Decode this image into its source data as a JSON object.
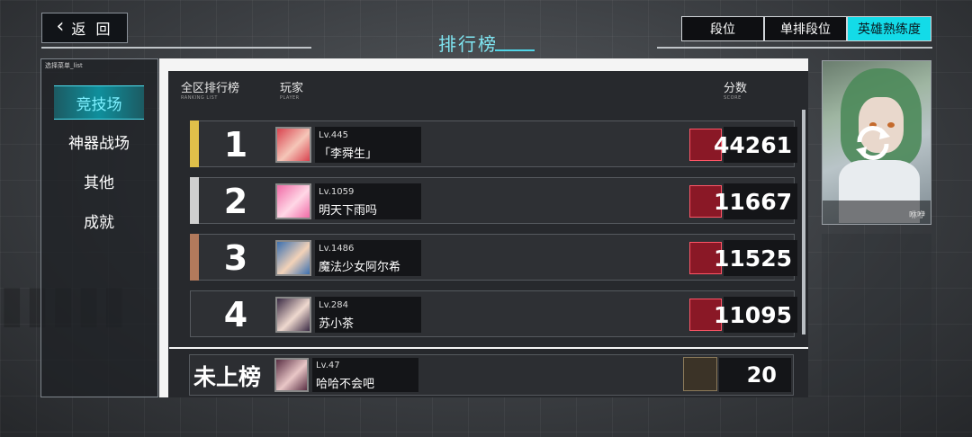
{
  "nav": {
    "back_label": "返 回"
  },
  "page": {
    "title": "排行榜"
  },
  "tabs": [
    {
      "label": "段位",
      "active": false
    },
    {
      "label": "单排段位",
      "active": false
    },
    {
      "label": "英雄熟练度",
      "active": true
    }
  ],
  "sidebar": {
    "caption": "选择菜单_list",
    "items": [
      {
        "label": "竞技场",
        "active": true
      },
      {
        "label": "神器战场",
        "active": false
      },
      {
        "label": "其他",
        "active": false
      },
      {
        "label": "成就",
        "active": false
      }
    ]
  },
  "leaderboard": {
    "headers": {
      "rank_label": "全区排行榜",
      "rank_sub": "RANKING LIST",
      "player_label": "玩家",
      "player_sub": "PLAYER",
      "score_label": "分数",
      "score_sub": "SCORE"
    },
    "rows": [
      {
        "rank": "1",
        "level": "Lv.445",
        "name": "「李舜生」",
        "score": "44261",
        "stripe_color": "#e0c04a",
        "avatar_colors": [
          "#d9434f",
          "#f5c6b8"
        ]
      },
      {
        "rank": "2",
        "level": "Lv.1059",
        "name": "明天下雨吗",
        "score": "11667",
        "stripe_color": "#cfcfcf",
        "avatar_colors": [
          "#f06aa6",
          "#ffd7e6"
        ]
      },
      {
        "rank": "3",
        "level": "Lv.1486",
        "name": "魔法少女阿尔希",
        "score": "11525",
        "stripe_color": "#b27a5c",
        "avatar_colors": [
          "#3a6fb0",
          "#f2d2b8"
        ]
      },
      {
        "rank": "4",
        "level": "Lv.284",
        "name": "苏小茶",
        "score": "11095",
        "stripe_color": "",
        "avatar_colors": [
          "#3a2a44",
          "#efd9cf"
        ]
      }
    ],
    "self": {
      "rank": "未上榜",
      "level": "Lv.47",
      "name": "哈哈不会吧",
      "score": "20",
      "avatar_colors": [
        "#5a2f44",
        "#e9c7c7"
      ]
    }
  },
  "hero_card": {
    "footer_text": "咻咿"
  },
  "colors": {
    "accent": "#13dbe8",
    "title": "#7fe6f2",
    "badge_red": "#8a1826"
  }
}
